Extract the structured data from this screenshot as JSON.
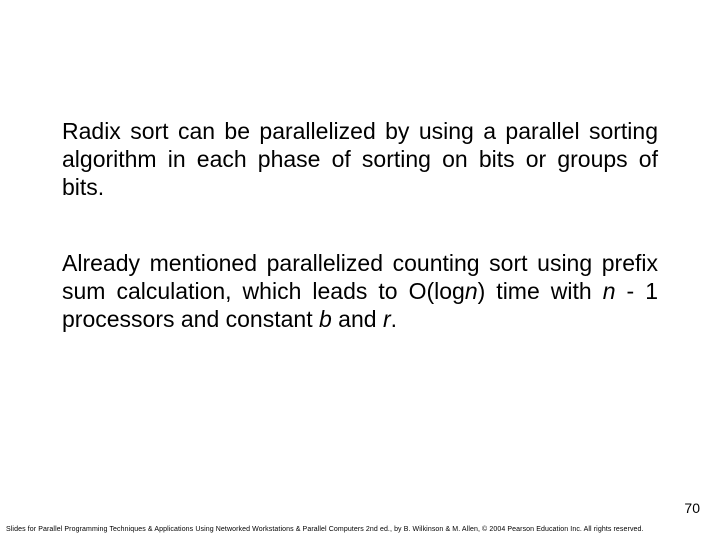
{
  "paragraph1": "Radix sort can be parallelized by using a parallel sorting algorithm in each phase of sorting on bits or groups of bits.",
  "p2_a": "Already mentioned parallelized counting sort using prefix sum calculation, which leads to O(log",
  "p2_n1": "n",
  "p2_b": ") time with ",
  "p2_n2": "n",
  "p2_c": " - 1 processors and constant ",
  "p2_b_it": "b",
  "p2_d": " and ",
  "p2_r_it": "r",
  "p2_e": ".",
  "page_number": "70",
  "footer": "Slides for Parallel Programming Techniques & Applications Using Networked Workstations & Parallel Computers 2nd ed., by B. Wilkinson & M. Allen, © 2004 Pearson Education Inc. All rights reserved."
}
